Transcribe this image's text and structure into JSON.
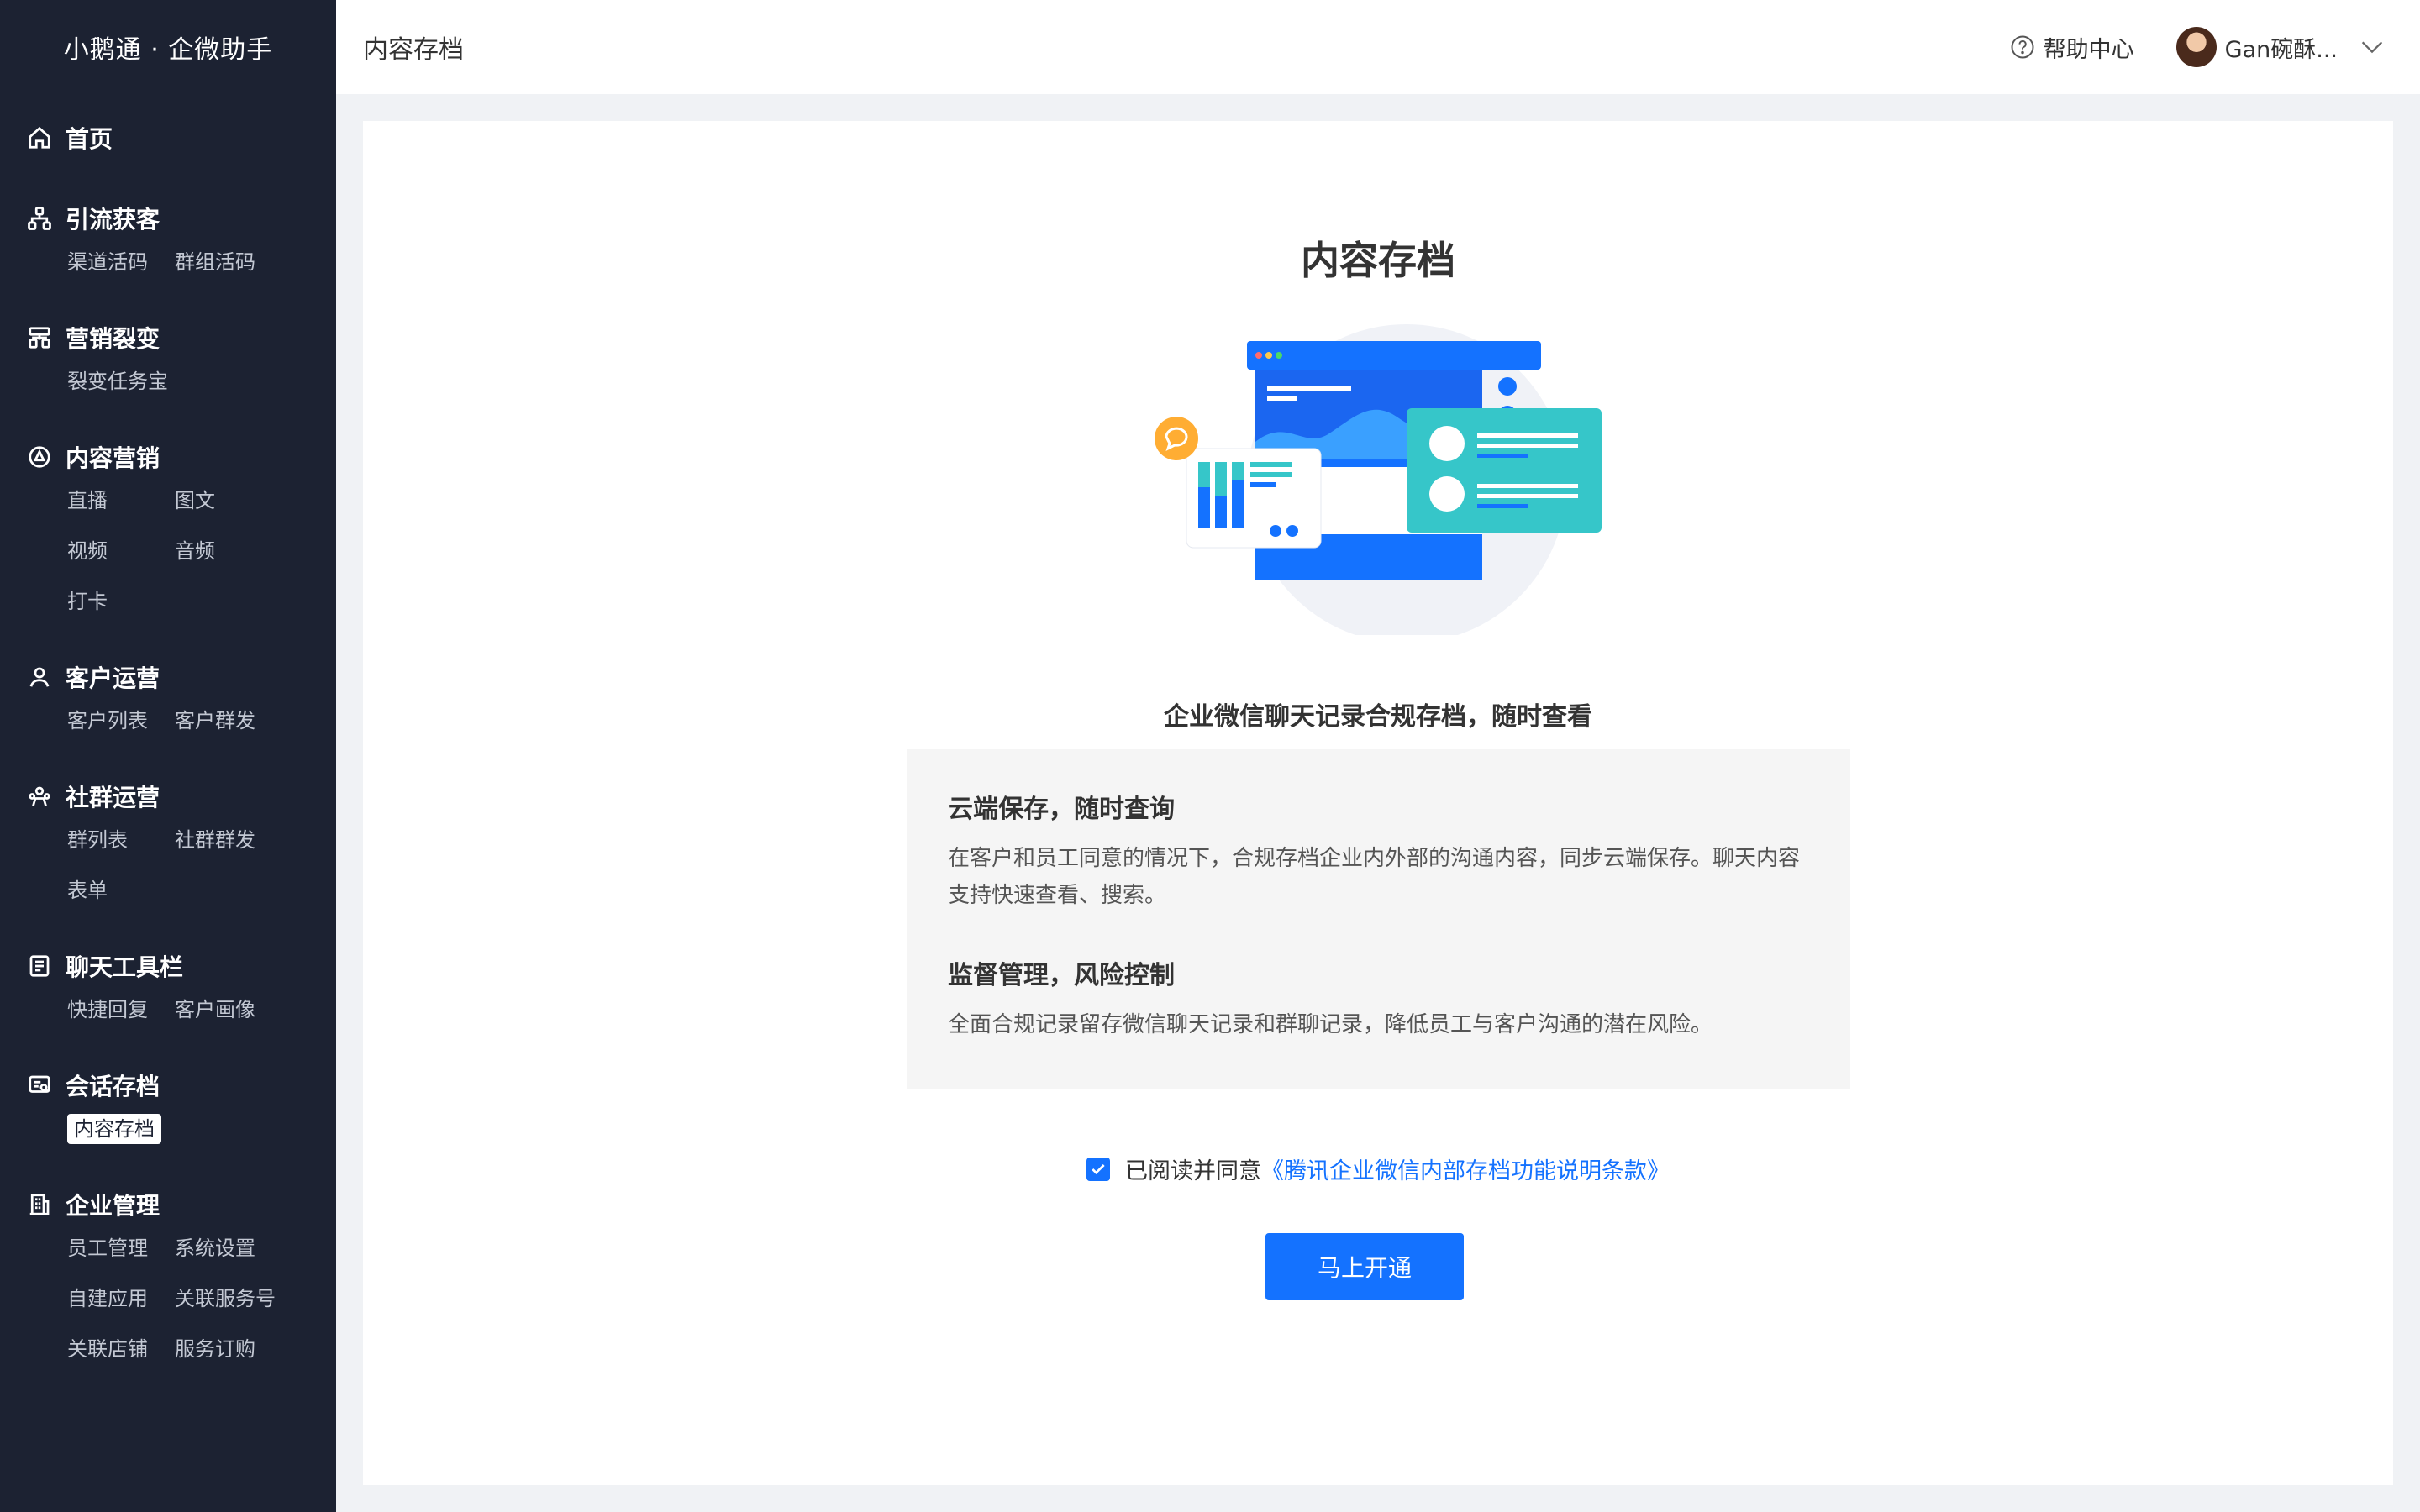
{
  "sidebar": {
    "brand": "小鹅通 · 企微助手",
    "groups": [
      {
        "label": "首页",
        "icon": "home-icon",
        "items": []
      },
      {
        "label": "引流获客",
        "icon": "network-icon",
        "items": [
          "渠道活码",
          "群组活码"
        ]
      },
      {
        "label": "营销裂变",
        "icon": "hierarchy-icon",
        "items": [
          "裂变任务宝"
        ]
      },
      {
        "label": "内容营销",
        "icon": "content-icon",
        "items": [
          "直播",
          "图文",
          "视频",
          "音频",
          "打卡"
        ]
      },
      {
        "label": "客户运营",
        "icon": "user-icon",
        "items": [
          "客户列表",
          "客户群发"
        ]
      },
      {
        "label": "社群运营",
        "icon": "community-icon",
        "items": [
          "群列表",
          "社群群发",
          "表单"
        ]
      },
      {
        "label": "聊天工具栏",
        "icon": "toolbar-icon",
        "items": [
          "快捷回复",
          "客户画像"
        ]
      },
      {
        "label": "会话存档",
        "icon": "archive-icon",
        "items": [
          "内容存档"
        ]
      },
      {
        "label": "企业管理",
        "icon": "building-icon",
        "items": [
          "员工管理",
          "系统设置",
          "自建应用",
          "关联服务号",
          "关联店铺",
          "服务订购"
        ]
      }
    ],
    "active_item": "内容存档"
  },
  "header": {
    "page_title": "内容存档",
    "help_label": "帮助中心",
    "user_name": "Gan碗酥..."
  },
  "main": {
    "title": "内容存档",
    "subtitle": "企业微信聊天记录合规存档，随时查看",
    "features": [
      {
        "title": "云端保存，随时查询",
        "desc": "在客户和员工同意的情况下，合规存档企业内外部的沟通内容，同步云端保存。聊天内容支持快速查看、搜索。"
      },
      {
        "title": "监督管理，风险控制",
        "desc": "全面合规记录留存微信聊天记录和群聊记录，降低员工与客户沟通的潜在风险。"
      }
    ],
    "agree_text": "已阅读并同意",
    "agree_link": "《腾讯企业微信内部存档功能说明条款》",
    "agree_checked": true,
    "button_label": "马上开通"
  },
  "colors": {
    "sidebar_bg": "#1c2232",
    "primary": "#1472ff",
    "teal": "#36c6c9"
  }
}
